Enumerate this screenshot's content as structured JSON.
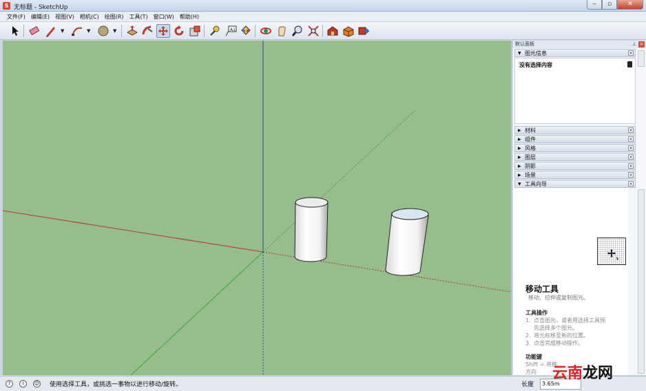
{
  "window": {
    "title": "无标题 - SketchUp",
    "app_icon": "sketchup-icon",
    "buttons": [
      "minimize",
      "maximize",
      "close"
    ]
  },
  "menu": [
    "文件(F)",
    "编辑(E)",
    "视图(V)",
    "相机(C)",
    "绘图(R)",
    "工具(T)",
    "窗口(W)",
    "帮助(H)"
  ],
  "toolbar": {
    "tools": [
      {
        "icon": "select-arrow-icon"
      },
      {
        "icon": "eraser-icon"
      },
      {
        "icon": "pencil-icon"
      },
      {
        "icon": "arc-icon"
      },
      {
        "icon": "circle-icon"
      },
      {
        "icon": "push-pull-icon"
      },
      {
        "icon": "follow-me-icon"
      },
      {
        "icon": "move-icon",
        "active": true
      },
      {
        "icon": "rotate-icon"
      },
      {
        "icon": "scale-icon"
      },
      {
        "icon": "tape-measure-icon"
      },
      {
        "icon": "text-icon"
      },
      {
        "icon": "paint-bucket-icon"
      },
      {
        "icon": "orbit-icon"
      },
      {
        "icon": "pan-icon"
      },
      {
        "icon": "zoom-icon"
      },
      {
        "icon": "zoom-extents-icon"
      },
      {
        "icon": "warehouse-icon"
      },
      {
        "icon": "components-icon"
      },
      {
        "icon": "share-model-icon"
      }
    ]
  },
  "viewport": {
    "background": "#97bd8c",
    "axis_colors": {
      "red": "#b03a2e",
      "green": "#3ba33b",
      "blue": "#2e4fb0"
    }
  },
  "panel": {
    "title": "默认面板",
    "entity_info": {
      "label": "图元信息",
      "content": "没有选择内容"
    },
    "trays": [
      "材料",
      "组件",
      "风格",
      "图层",
      "阴影",
      "场景"
    ],
    "instructor": {
      "label": "工具向导",
      "title": "移动工具",
      "subtitle": "移动、拉伸或复制图元。",
      "ops_heading": "工具操作",
      "ops": [
        {
          "n": "1.",
          "text": "点击图元，或者用选择工具预"
        },
        {
          "n": "",
          "text": "先选择多个图元。"
        },
        {
          "n": "2.",
          "text": "将光标移至新的位置。"
        },
        {
          "n": "3.",
          "text": "点击完成移动操作。"
        }
      ],
      "keys_heading": "功能键",
      "keys": [
        "Shift = 将移",
        "方向"
      ]
    }
  },
  "status": {
    "message": "使用选择工具，或挑选一事物以进行移动/旋转。",
    "length_label": "长度",
    "length_value": "3.65m"
  },
  "watermark": {
    "text_red": "云南",
    "text_black": "龙网"
  }
}
